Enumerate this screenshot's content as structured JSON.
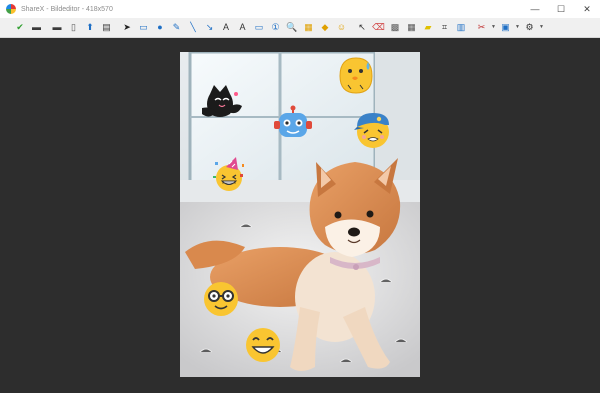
{
  "window": {
    "title": "ShareX - Bildeditor - 418x570",
    "buttons": [
      {
        "name": "minimize-button",
        "glyph": "—"
      },
      {
        "name": "maximize-button",
        "glyph": "☐"
      },
      {
        "name": "close-button",
        "glyph": "✕"
      }
    ]
  },
  "toolbar": {
    "tools": [
      {
        "name": "confirm-check-icon",
        "glyph": "✔",
        "color": "#2e9e2e"
      },
      {
        "name": "save-icon",
        "glyph": "▬",
        "color": "#3a3a3a"
      },
      {
        "name": "save-as-icon",
        "glyph": "▬",
        "color": "#3a3a3a"
      },
      {
        "name": "copy-icon",
        "glyph": "▯",
        "color": "#555555"
      },
      {
        "name": "upload-icon",
        "glyph": "⬆",
        "color": "#1e6fc5"
      },
      {
        "name": "print-icon",
        "glyph": "▤",
        "color": "#3a3a3a"
      },
      {
        "name": "select-cursor-icon",
        "glyph": "➤",
        "color": "#222222"
      },
      {
        "name": "rectangle-icon",
        "glyph": "▭",
        "color": "#1e6fc5"
      },
      {
        "name": "ellipse-icon",
        "glyph": "●",
        "color": "#1e6fc5"
      },
      {
        "name": "freehand-icon",
        "glyph": "✎",
        "color": "#1e6fc5"
      },
      {
        "name": "line-icon",
        "glyph": "╲",
        "color": "#1e6fc5"
      },
      {
        "name": "arrow-icon",
        "glyph": "↘",
        "color": "#1e6fc5"
      },
      {
        "name": "text-outline-icon",
        "glyph": "A",
        "color": "#333333"
      },
      {
        "name": "text-background-icon",
        "glyph": "A",
        "color": "#333333"
      },
      {
        "name": "speech-balloon-icon",
        "glyph": "▭",
        "color": "#1e6fc5"
      },
      {
        "name": "step-number-icon",
        "glyph": "①",
        "color": "#1e6fc5"
      },
      {
        "name": "magnify-icon",
        "glyph": "🔍",
        "color": "#1e6fc5"
      },
      {
        "name": "image-file-icon",
        "glyph": "▦",
        "color": "#e0a000"
      },
      {
        "name": "sticker-icon",
        "glyph": "◆",
        "color": "#e0a000"
      },
      {
        "name": "emoji-icon",
        "glyph": "☺",
        "color": "#e0a000"
      },
      {
        "name": "cursor-tool-icon",
        "glyph": "↖",
        "color": "#333333"
      },
      {
        "name": "smart-eraser-icon",
        "glyph": "⌫",
        "color": "#d04040"
      },
      {
        "name": "blur-icon",
        "glyph": "▩",
        "color": "#555555"
      },
      {
        "name": "pixelate-icon",
        "glyph": "▦",
        "color": "#555555"
      },
      {
        "name": "highlight-icon",
        "glyph": "▰",
        "color": "#e0c000"
      },
      {
        "name": "crop-icon",
        "glyph": "⌗",
        "color": "#333333"
      },
      {
        "name": "cut-out-icon",
        "glyph": "▥",
        "color": "#1e6fc5"
      },
      {
        "name": "edit-tools-icon",
        "glyph": "✂",
        "color": "#c03030"
      },
      {
        "name": "image-options-icon",
        "glyph": "▣",
        "color": "#1e6fc5"
      },
      {
        "name": "settings-gear-icon",
        "glyph": "⚙",
        "color": "#333333"
      }
    ]
  },
  "stickers": [
    {
      "name": "black-cat-hug-sticker"
    },
    {
      "name": "sweating-chick-sticker"
    },
    {
      "name": "robot-sticker"
    },
    {
      "name": "cap-smiley-sticker"
    },
    {
      "name": "party-smiley-sticker"
    },
    {
      "name": "nerd-glasses-smiley-sticker"
    },
    {
      "name": "grinning-smiley-sticker"
    }
  ]
}
